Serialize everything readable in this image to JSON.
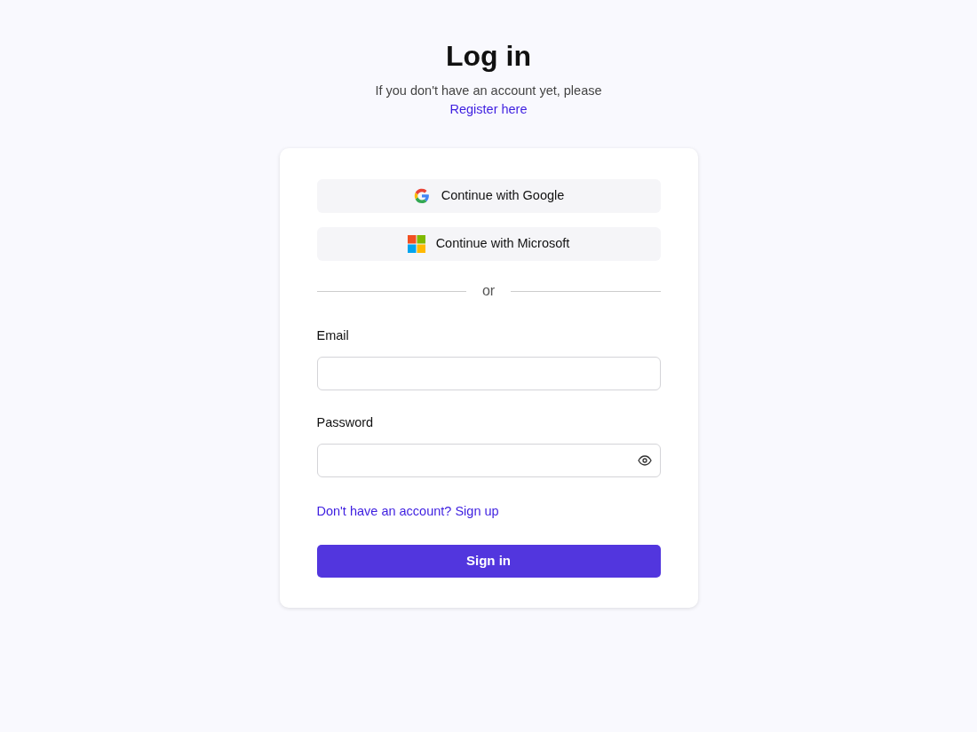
{
  "title": "Log in",
  "subtitle": "If you don't have an account yet, please",
  "register_link": "Register here",
  "social_buttons": [
    {
      "kind": "google",
      "label": "Continue with Google"
    },
    {
      "kind": "microsoft",
      "label": "Continue with Microsoft"
    }
  ],
  "divider": "or",
  "fields": [
    {
      "kind": "text",
      "label": "Email"
    },
    {
      "kind": "password",
      "label": "Password"
    }
  ],
  "signup_link": "Don't have an account? Sign up",
  "submit": "Sign in"
}
